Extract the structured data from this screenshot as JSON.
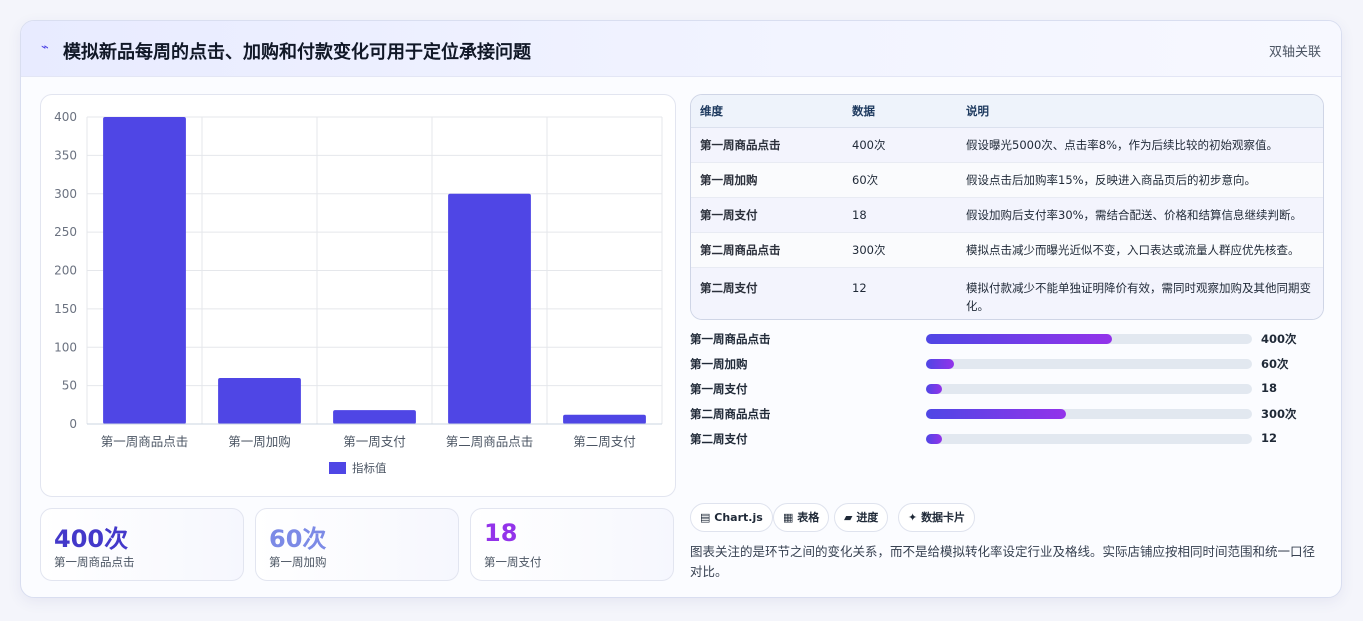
{
  "header": {
    "icon": "chart-line-icon",
    "title": "模拟新品每周的点击、加购和付款变化可用于定位承接问题",
    "tag": "双轴关联"
  },
  "chart_data": {
    "type": "bar",
    "categories": [
      "第一周商品点击",
      "第一周加购",
      "第一周支付",
      "第二周商品点击",
      "第二周支付"
    ],
    "series": [
      {
        "name": "指标值",
        "values": [
          400,
          60,
          18,
          300,
          12
        ]
      }
    ],
    "ylim": [
      0,
      400
    ],
    "yticks": [
      0,
      50,
      100,
      150,
      200,
      250,
      300,
      350,
      400
    ],
    "grid": true,
    "legend": "bottom",
    "bar_color": "#4f46e5"
  },
  "kpis": [
    {
      "value": "400次",
      "label": "第一周商品点击",
      "color": "#4338ca"
    },
    {
      "value": "60次",
      "label": "第一周加购",
      "color": "#7c8ae6"
    },
    {
      "value": "18",
      "label": "第一周支付",
      "color": "#9333ea"
    }
  ],
  "table": {
    "headers": [
      "维度",
      "数据",
      "说明"
    ],
    "rows": [
      [
        "第一周商品点击",
        "400次",
        "假设曝光5000次、点击率8%，作为后续比较的初始观察值。"
      ],
      [
        "第一周加购",
        "60次",
        "假设点击后加购率15%，反映进入商品页后的初步意向。"
      ],
      [
        "第一周支付",
        "18",
        "假设加购后支付率30%，需结合配送、价格和结算信息继续判断。"
      ],
      [
        "第二周商品点击",
        "300次",
        "模拟点击减少而曝光近似不变，入口表达或流量人群应优先核查。"
      ],
      [
        "第二周支付",
        "12",
        "模拟付款减少不能单独证明降价有效，需同时观察加购及其他同期变化。"
      ]
    ]
  },
  "progress": {
    "max": 700,
    "items": [
      {
        "label": "第一周商品点击",
        "value": 400,
        "text": "400次"
      },
      {
        "label": "第一周加购",
        "value": 60,
        "text": "60次"
      },
      {
        "label": "第一周支付",
        "value": 18,
        "text": "18"
      },
      {
        "label": "第二周商品点击",
        "value": 300,
        "text": "300次"
      },
      {
        "label": "第二周支付",
        "value": 12,
        "text": "12"
      }
    ]
  },
  "chips": [
    {
      "icon": "chart-icon",
      "glyph": "▤",
      "label": "Chart.js"
    },
    {
      "icon": "table-icon",
      "glyph": "▦",
      "label": "表格"
    },
    {
      "icon": "progress-icon",
      "glyph": "▰",
      "label": "进度"
    },
    {
      "icon": "sparkle-icon",
      "glyph": "✦",
      "label": "数据卡片"
    }
  ],
  "note": "图表关注的是环节之间的变化关系，而不是给模拟转化率设定行业及格线。实际店铺应按相同时间范围和统一口径对比。"
}
